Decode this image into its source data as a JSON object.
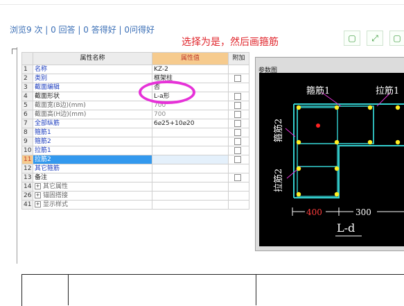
{
  "stats": {
    "text": "浏览9 次 | 0 回答 | 0 答得好 | 0问得好"
  },
  "note": "选择为是，然后画箍筋",
  "toolbar": [
    {
      "name": "window-button",
      "glyph": "▢"
    },
    {
      "name": "expand-button",
      "glyph": "⤢"
    },
    {
      "name": "restore-button",
      "glyph": "▢"
    }
  ],
  "grid": {
    "headers": {
      "name": "属性名称",
      "value": "属性值",
      "extra": "附加"
    },
    "rows": [
      {
        "num": "1",
        "name": "名称",
        "value": "KZ-2",
        "check": false,
        "style": "link"
      },
      {
        "num": "2",
        "name": "类别",
        "value": "框架柱",
        "check": true,
        "style": "link"
      },
      {
        "num": "3",
        "name": "截面编辑",
        "value": "否",
        "check": false,
        "style": "link"
      },
      {
        "num": "4",
        "name": "截面形状",
        "value": "L-a形",
        "check": true,
        "style": "plain"
      },
      {
        "num": "5",
        "name": "截面宽(B边)(mm)",
        "value": "700",
        "check": true,
        "style": "grey",
        "dim": true
      },
      {
        "num": "6",
        "name": "截面高(H边)(mm)",
        "value": "700",
        "check": true,
        "style": "grey",
        "dim": true
      },
      {
        "num": "7",
        "name": "全部纵筋",
        "value": "6⌀25+10⌀20",
        "check": true,
        "style": "link"
      },
      {
        "num": "8",
        "name": "箍筋1",
        "value": "",
        "check": true,
        "style": "link"
      },
      {
        "num": "9",
        "name": "箍筋2",
        "value": "",
        "check": true,
        "style": "link"
      },
      {
        "num": "10",
        "name": "拉筋1",
        "value": "",
        "check": true,
        "style": "link"
      },
      {
        "num": "11",
        "name": "拉筋2",
        "value": "",
        "check": true,
        "style": "link",
        "selected": true
      },
      {
        "num": "12",
        "name": "其它箍筋",
        "value": "",
        "check": false,
        "style": "link"
      },
      {
        "num": "13",
        "name": "备注",
        "value": "",
        "check": true,
        "style": "plain"
      },
      {
        "num": "14",
        "name": "其它属性",
        "value": "",
        "check": false,
        "style": "grey",
        "expand": true
      },
      {
        "num": "26",
        "name": "锚固搭接",
        "value": "",
        "check": false,
        "style": "grey",
        "expand": true
      },
      {
        "num": "41",
        "name": "显示样式",
        "value": "",
        "check": false,
        "style": "grey",
        "expand": true
      }
    ]
  },
  "panel": {
    "title": "参数图",
    "labels": {
      "top_left": "箍筋1",
      "top_right": "拉筋1",
      "left_top": "箍筋2",
      "left_bottom": "拉筋2",
      "dim1": "400",
      "dim2": "300",
      "shape": "L-d"
    }
  }
}
